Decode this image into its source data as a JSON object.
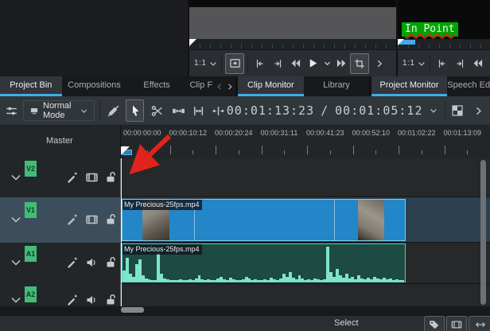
{
  "colors": {
    "accent": "#3daee9",
    "video_clip": "#2386c8",
    "video_clip_border": "#7ad0f0",
    "audio_clip": "#1d4a42",
    "audio_clip_border": "#4ecdd6",
    "waveform": "#7fe5c5",
    "track_tag": "#42bd78",
    "annotation_arrow": "#e0241b",
    "inpoint_badge": "#00a400"
  },
  "monitors": {
    "clip": {
      "zoom_level": "1:1"
    },
    "project": {
      "zoom_level": "1:1",
      "overlay_text": "In Point"
    }
  },
  "tabs": {
    "left": [
      {
        "label": "Project Bin",
        "active": true
      },
      {
        "label": "Compositions",
        "active": false
      },
      {
        "label": "Effects",
        "active": false
      },
      {
        "label": "Clip F",
        "active": false
      }
    ],
    "middle": [
      {
        "label": "Clip Monitor",
        "active": true
      },
      {
        "label": "Library",
        "active": false
      }
    ],
    "right": [
      {
        "label": "Project Monitor",
        "active": true
      },
      {
        "label": "Speech Ed",
        "active": false
      }
    ]
  },
  "toolbar": {
    "edit_mode": "Normal Mode",
    "timecode_current": "00:01:13:23",
    "timecode_separator": "/",
    "timecode_total": "00:01:05:12"
  },
  "timeline": {
    "master_label": "Master",
    "ruler_labels": [
      "00:00:00:00",
      "00:00:10:12",
      "00:00:20:24",
      "00:00:31:11",
      "00:00:41:23",
      "00:00:52:10",
      "00:01:02:22",
      "00:01:13:09"
    ],
    "tracks": [
      {
        "id": "V2",
        "type": "video",
        "selected": false
      },
      {
        "id": "V1",
        "type": "video",
        "selected": true
      },
      {
        "id": "A1",
        "type": "audio",
        "selected": false
      },
      {
        "id": "A2",
        "type": "audio",
        "selected": false
      }
    ],
    "clips": {
      "video": {
        "label": "My Precious-25fps.mp4",
        "track": "V1"
      },
      "audio": {
        "label": "My Precious-25fps.mp4",
        "track": "A1",
        "waveform": [
          14,
          30,
          10,
          6,
          22,
          28,
          8,
          4,
          3,
          2,
          2,
          36,
          10,
          4,
          3,
          2,
          2,
          2,
          3,
          2,
          2,
          3,
          2,
          4,
          8,
          3,
          2,
          3,
          2,
          2,
          4,
          6,
          3,
          2,
          5,
          3,
          2,
          2,
          3,
          6,
          4,
          2,
          3,
          2,
          2,
          3,
          2,
          5,
          3,
          2,
          4,
          10,
          6,
          12,
          5,
          3,
          8,
          4,
          2,
          3,
          2,
          4,
          3,
          2,
          3,
          44,
          12,
          6,
          16,
          8,
          5,
          10,
          4,
          6,
          3,
          8,
          4,
          3,
          5,
          3,
          6,
          4,
          3,
          5,
          3,
          4,
          2,
          3,
          2,
          2
        ]
      }
    }
  },
  "statusbar": {
    "tool": "Select"
  }
}
